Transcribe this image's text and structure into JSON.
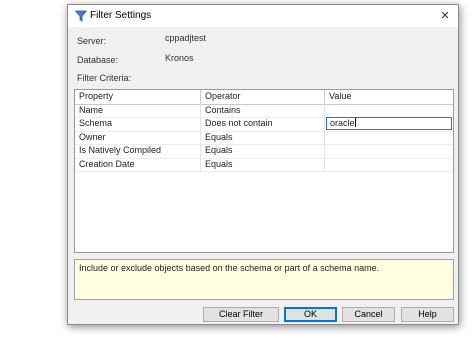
{
  "dialog": {
    "title": "Filter Settings",
    "close_glyph": "×",
    "icon": "filter-funnel-icon",
    "accent_color": "#2f6ec9"
  },
  "fields": {
    "server_label": "Server:",
    "server_value": "cppadjtest",
    "database_label": "Database:",
    "database_value": "Kronos",
    "criteria_label": "Filter Criteria:"
  },
  "grid": {
    "headers": [
      "Property",
      "Operator",
      "Value"
    ],
    "rows": [
      {
        "property": "Name",
        "operator": "Contains",
        "value": ""
      },
      {
        "property": "Schema",
        "operator": "Does not contain",
        "value": "oracle"
      },
      {
        "property": "Owner",
        "operator": "Equals",
        "value": ""
      },
      {
        "property": "Is Natively Compiled",
        "operator": "Equals",
        "value": ""
      },
      {
        "property": "Creation Date",
        "operator": "Equals",
        "value": ""
      }
    ]
  },
  "description": "Include or exclude objects based on the schema or part of a schema name.",
  "buttons": {
    "clear_filter": "Clear Filter",
    "ok": "OK",
    "cancel": "Cancel",
    "help": "Help"
  }
}
